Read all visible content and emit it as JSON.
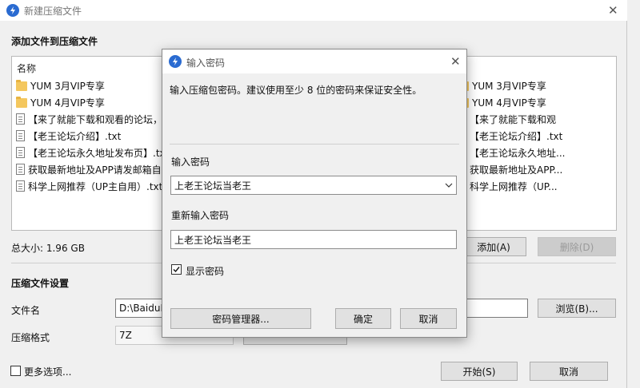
{
  "main_window": {
    "title": "新建压缩文件",
    "add_section_title": "添加文件到压缩文件",
    "list_header": "名称",
    "files_left": [
      {
        "name": "YUM 3月VIP专享",
        "type": "folder"
      },
      {
        "name": "YUM 4月VIP专享",
        "type": "folder"
      },
      {
        "name": "【来了就能下载和观看的论坛，",
        "type": "doc"
      },
      {
        "name": "【老王论坛介绍】.txt",
        "type": "doc"
      },
      {
        "name": "【老王论坛永久地址发布页】.tx",
        "type": "doc"
      },
      {
        "name": "获取最新地址及APP请发邮箱自",
        "type": "doc"
      },
      {
        "name": "科学上网推荐（UP主自用）.txt",
        "type": "doc"
      }
    ],
    "files_right": [
      {
        "name": "YUM 3月VIP专享",
        "type": "folder"
      },
      {
        "name": "YUM 4月VIP专享",
        "type": "folder"
      },
      {
        "name": "【来了就能下载和观",
        "type": "doc"
      },
      {
        "name": "【老王论坛介绍】.txt",
        "type": "doc"
      },
      {
        "name": "【老王论坛永久地址...",
        "type": "doc"
      },
      {
        "name": "获取最新地址及APP...",
        "type": "doc"
      },
      {
        "name": "科学上网推荐（UP...",
        "type": "doc"
      }
    ],
    "total_size": "总大小: 1.96 GB",
    "add_button": "添加(A)",
    "delete_button": "删除(D)",
    "settings_section_title": "压缩文件设置",
    "filename_label": "文件名",
    "filename_value": "D:\\BaiduN",
    "browse_button": "浏览(B)...",
    "format_label": "压缩格式",
    "format_value": "7Z",
    "more_options_label": "更多选项...",
    "start_button": "开始(S)",
    "cancel_button": "取消"
  },
  "dialog": {
    "title": "输入密码",
    "description": "输入压缩包密码。建议使用至少 8 位的密码来保证安全性。",
    "password_label": "输入密码",
    "password_value": "上老王论坛当老王",
    "repeat_label": "重新输入密码",
    "repeat_value": "上老王论坛当老王",
    "show_password_label": "显示密码",
    "show_password_checked": true,
    "manager_button": "密码管理器...",
    "ok_button": "确定",
    "cancel_button": "取消"
  },
  "colors": {
    "accent": "#2a6bd1",
    "window_bg": "#f0f0f0",
    "button_bg": "#e1e1e1"
  }
}
